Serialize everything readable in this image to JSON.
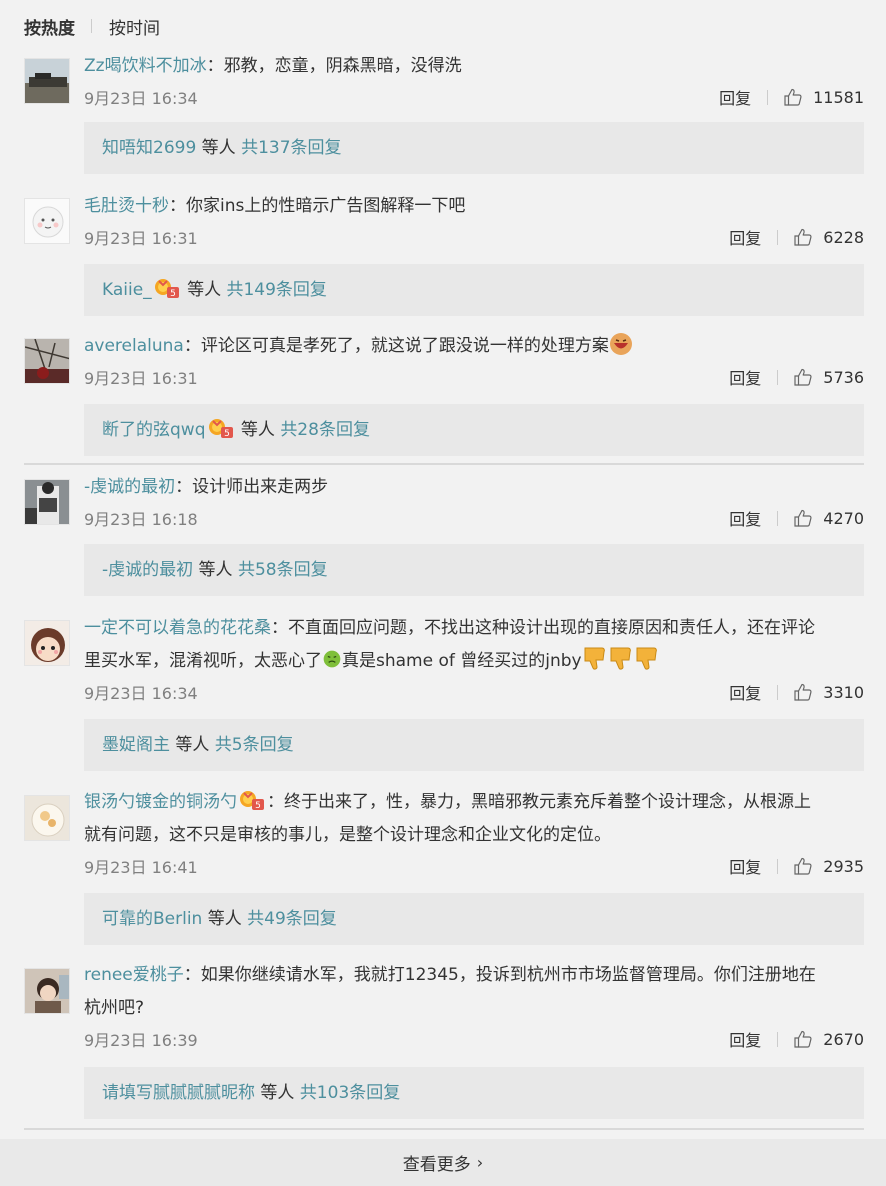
{
  "sort": {
    "hot": "按热度",
    "time": "按时间"
  },
  "labels": {
    "reply": "回复",
    "colon": "：",
    "etc": " 等人 "
  },
  "comments": [
    {
      "user": "Zz喝饮料不加冰",
      "text": "邪教，恋童，阴森黑暗，没得洗",
      "time": "9月23日 16:34",
      "likes": "11581",
      "reply_user": "知唔知2699",
      "reply_count": "共137条回复",
      "avatar": "landscape"
    },
    {
      "user": "毛肚烫十秒",
      "text": "你家ins上的性暗示广告图解释一下吧",
      "time": "9月23日 16:31",
      "likes": "6228",
      "reply_user": "Kaiie_",
      "reply_count": "共149条回复",
      "avatar": "face"
    },
    {
      "user": "averelaluna",
      "text": "评论区可真是孝死了，就这说了跟没说一样的处理方案",
      "time": "9月23日 16:31",
      "likes": "5736",
      "reply_user": "断了的弦qwq",
      "reply_count": "共28条回复",
      "avatar": "tree"
    },
    {
      "user": "-虔诚的最初",
      "text": "设计师出来走两步",
      "time": "9月23日 16:18",
      "likes": "4270",
      "reply_user": "-虔诚的最初",
      "reply_count": "共58条回复",
      "avatar": "person"
    },
    {
      "user": "一定不可以着急的花花桑",
      "text_line1": "不直面回应问题，不找出这种设计出现的直接原因和责任人，还在评论",
      "text_line2a": "里买水军，混淆视听，太恶心了",
      "text_line2b": "真是shame of 曾经买过的jnby",
      "time": "9月23日 16:34",
      "likes": "3310",
      "reply_user": "墨娖阁主",
      "reply_count": "共5条回复",
      "avatar": "doll"
    },
    {
      "user": "银汤勺镀金的铜汤勺",
      "text_line1": "终于出来了，性，暴力，黑暗邪教元素充斥着整个设计理念，从根源上",
      "text_line2": "就有问题，这不只是审核的事儿，是整个设计理念和企业文化的定位。",
      "time": "9月23日 16:41",
      "likes": "2935",
      "reply_user": "可靠的Berlin",
      "reply_count": "共49条回复",
      "avatar": "food"
    },
    {
      "user": "renee爱桃子",
      "text_line1": "如果你继续请水军，我就打12345，投诉到杭州市市场监督管理局。你们注册地在",
      "text_line2": "杭州吧?",
      "time": "9月23日 16:39",
      "likes": "2670",
      "reply_user": "请填写腻腻腻腻昵称",
      "reply_count": "共103条回复",
      "avatar": "girl"
    }
  ],
  "more": {
    "label": "查看更多"
  },
  "colors": {
    "link": "#4d8f9e",
    "panel": "#e8e8e8",
    "bg": "#f2f2f2"
  }
}
